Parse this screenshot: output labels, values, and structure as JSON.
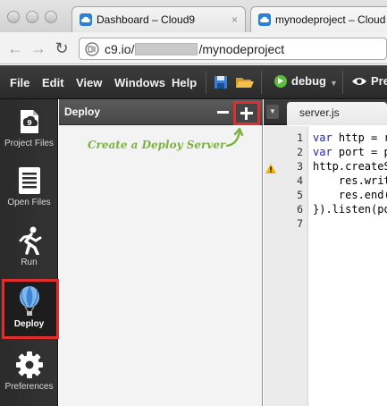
{
  "browser": {
    "tabs": [
      {
        "title": "Dashboard – Cloud9",
        "close": "×"
      },
      {
        "title": "mynodeproject – Cloud9",
        "close": "×"
      }
    ],
    "address": {
      "prefix": "c9.io/",
      "suffix": "/mynodeproject"
    }
  },
  "menubar": {
    "items": [
      "File",
      "Edit",
      "View",
      "Windows",
      "Help"
    ],
    "debug_label": "debug",
    "preview_label": "Pre"
  },
  "sidebar": {
    "items": [
      {
        "label": "Project Files",
        "icon": "project-files-icon"
      },
      {
        "label": "Open Files",
        "icon": "open-files-icon"
      },
      {
        "label": "Run",
        "icon": "run-icon"
      },
      {
        "label": "Deploy",
        "icon": "balloon-icon",
        "active": true
      },
      {
        "label": "Preferences",
        "icon": "gear-icon"
      }
    ]
  },
  "panel": {
    "title": "Deploy",
    "hint": "Create a Deploy Server"
  },
  "editor": {
    "tab": "server.js",
    "line_numbers": [
      "1",
      "2",
      "3",
      "4",
      "5",
      "6",
      "7"
    ],
    "lines": [
      {
        "kw": "var",
        "rest": " http = r"
      },
      {
        "kw": "var",
        "rest": " port = p"
      },
      {
        "kw": "",
        "rest": "http.createS"
      },
      {
        "kw": "",
        "rest": "    res.writ"
      },
      {
        "kw": "",
        "rest": "    res.end("
      },
      {
        "kw": "",
        "rest": "}).listen(po"
      },
      {
        "kw": "",
        "rest": ""
      }
    ]
  },
  "colors": {
    "highlight": "#e02e2e",
    "hint": "#7ab33e",
    "keyword": "#2121c7"
  }
}
